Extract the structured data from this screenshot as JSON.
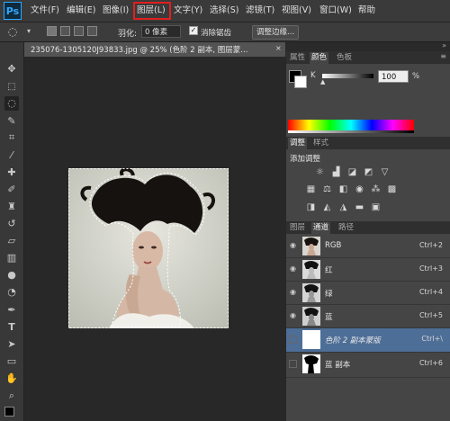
{
  "app": {
    "logo": "Ps"
  },
  "menubar": {
    "items": [
      "文件(F)",
      "编辑(E)",
      "图像(I)",
      "图层(L)",
      "文字(Y)",
      "选择(S)",
      "滤镜(T)",
      "视图(V)",
      "窗口(W)",
      "帮助"
    ],
    "highlighted": "图层(L)"
  },
  "options": {
    "feather_label": "羽化:",
    "feather_value": "0 像素",
    "antialias_label": "消除锯齿",
    "antialias_checked": true,
    "refine_edge_button": "调整边缘..."
  },
  "document": {
    "tab_label": "235076-1305120J93833.jpg @ 25% (色阶 2 副本, 图层蒙..."
  },
  "color_panel": {
    "tabs": [
      "属性",
      "颜色",
      "色板"
    ],
    "active_tab": "颜色",
    "channel": "K",
    "value": "100",
    "unit": "%",
    "foreground_color": "#000000",
    "background_color": "#ffffff"
  },
  "adjust_panel": {
    "tabs": [
      "调整",
      "样式"
    ],
    "active_tab": "调整",
    "title": "添加调整",
    "icons": [
      "brightness-icon",
      "levels-icon",
      "curves-icon",
      "exposure-icon",
      "vibrance-icon",
      "hue-saturation-icon",
      "color-balance-icon",
      "black-white-icon",
      "photo-filter-icon",
      "channel-mixer-icon",
      "color-lookup-icon",
      "invert-icon",
      "posterize-icon",
      "threshold-icon",
      "gradient-map-icon",
      "selective-color-icon"
    ]
  },
  "layers_panel": {
    "tabs": [
      "图层",
      "通道",
      "路径"
    ],
    "active_tab": "通道",
    "rows": [
      {
        "name": "RGB",
        "shortcut": "Ctrl+2",
        "visible": true,
        "selected": false,
        "italic": false
      },
      {
        "name": "红",
        "shortcut": "Ctrl+3",
        "visible": true,
        "selected": false,
        "italic": false
      },
      {
        "name": "绿",
        "shortcut": "Ctrl+4",
        "visible": true,
        "selected": false,
        "italic": false
      },
      {
        "name": "蓝",
        "shortcut": "Ctrl+5",
        "visible": true,
        "selected": false,
        "italic": false
      },
      {
        "name": "色阶 2 副本蒙版",
        "shortcut": "Ctrl+\\",
        "visible": false,
        "selected": true,
        "italic": true
      },
      {
        "name": "蓝 副本",
        "shortcut": "Ctrl+6",
        "visible": false,
        "selected": false,
        "italic": false
      }
    ]
  },
  "colors": {
    "accent_selection": "#4d6e97",
    "highlight_box": "#e02020"
  }
}
